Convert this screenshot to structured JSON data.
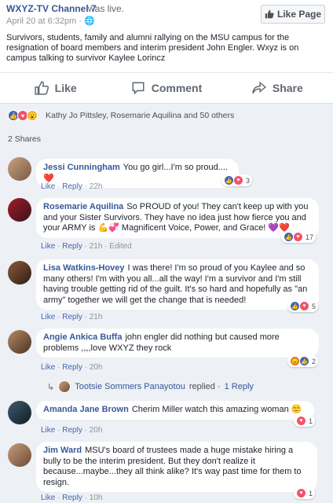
{
  "post": {
    "page_name": "WXYZ-TV Channel 7",
    "was_live": "was live.",
    "timestamp": "April 20 at 6:32pm · ",
    "like_page_label": "Like Page",
    "text": "Survivors, students, family and alumni rallying on the MSU campus for the resignation of board members and interim president John Engler. Wxyz is on campus talking to survivor Kaylee Lorincz"
  },
  "actions": {
    "like": "Like",
    "comment": "Comment",
    "share": "Share"
  },
  "reactions": {
    "names": "Kathy Jo Pittsley, Rosemarie Aquilina and 50 others",
    "icons": [
      "like-icon",
      "love-icon",
      "wow-icon"
    ]
  },
  "shares": "2 Shares",
  "comments": [
    {
      "author": "Jessi Cunningham",
      "text": "You go girl...I'm so proud.... ❤️",
      "like": "Like",
      "reply": "Reply",
      "age": "22h",
      "edited": "",
      "reaction_count": "3"
    },
    {
      "author": "Rosemarie Aquilina",
      "text": "So PROUD of you! They can't keep up with you and your Sister Survivors. They have no idea just how fierce you and your ARMY is 💪💞 Magnificent Voice, Power, and Grace! 💜❤️",
      "like": "Like",
      "reply": "Reply",
      "age": "21h",
      "edited": "Edited",
      "reaction_count": "17"
    },
    {
      "author": "Lisa Watkins-Hovey",
      "text": "I was there! I'm so proud of you Kaylee and so many others! I'm with you all...all the way! I'm a survivor and I'm still having trouble getting rid of the guilt. It's so hard and hopefully as \"an army\" together we will get the change that is needed!",
      "like": "Like",
      "reply": "Reply",
      "age": "21h",
      "edited": "",
      "reaction_count": "5"
    },
    {
      "author": "Angie Ankica Buffa",
      "text": "john engler did nothing but caused more problems ,,,,love WXYZ they rock",
      "like": "Like",
      "reply": "Reply",
      "age": "20h",
      "edited": "",
      "reaction_count": "2"
    },
    {
      "author": "Amanda Jane Brown",
      "text": "Cherim Miller watch this amazing woman 🙂",
      "like": "Like",
      "reply": "Reply",
      "age": "20h",
      "edited": "",
      "reaction_count": "1"
    },
    {
      "author": "Jim Ward",
      "text": "MSU's board of trustees made a huge mistake hiring a bully to be the interim president. But they don't realize it because...maybe...they all think alike? It's way past time for them to resign.",
      "like": "Like",
      "reply": "Reply",
      "age": "10h",
      "edited": "",
      "reaction_count": "1"
    }
  ],
  "reply_thread": {
    "name": "Tootsie Sommers Panayotou",
    "replied": "replied ·",
    "count": "1 Reply"
  },
  "colors": {
    "link_blue": "#365899",
    "like_blue": "#4267b2",
    "love_red": "#f25268",
    "wow_yellow": "#f7b125",
    "background": "#edf0f5"
  }
}
